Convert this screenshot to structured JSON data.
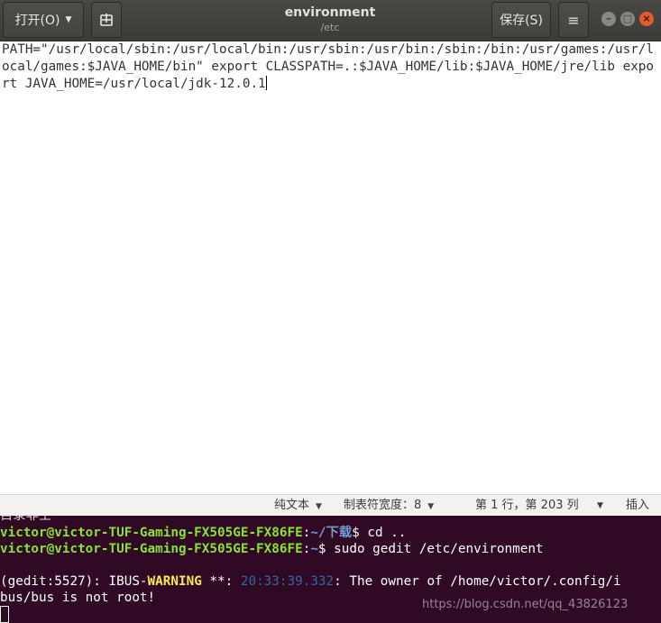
{
  "window": {
    "title": "environment",
    "subtitle": "/etc",
    "open_label": "打开(O)",
    "save_label": "保存(S)",
    "pin_icon": "new-document-icon",
    "menu_icon": "hamburger-menu-icon"
  },
  "editor": {
    "content": "PATH=\"/usr/local/sbin:/usr/local/bin:/usr/sbin:/usr/bin:/sbin:/bin:/usr/games:/usr/local/games:$JAVA_HOME/bin\" export CLASSPATH=.:$JAVA_HOME/lib:$JAVA_HOME/jre/lib export JAVA_HOME=/usr/local/jdk-12.0.1"
  },
  "statusbar": {
    "syntax": "纯文本",
    "tab_width": "制表符宽度：8",
    "position": "第 1 行，第 203 列",
    "mode": "插入"
  },
  "terminal": {
    "clipped_line": "目录非空",
    "line1_user": "victor@victor-TUF-Gaming-FX505GE-FX86FE",
    "line1_sep": ":",
    "line1_path": "~/下载",
    "line1_cmd": "$ cd ..",
    "line2_user": "victor@victor-TUF-Gaming-FX505GE-FX86FE",
    "line2_sep": ":",
    "line2_path": "~",
    "line2_cmd": "$ sudo gedit /etc/environment",
    "line3_prefix": "(gedit:5527): IBUS-",
    "line3_warning": "WARNING",
    "line3_mid": " **: ",
    "line3_time": "20:33:39.332",
    "line3_rest": ": The owner of /home/victor/.config/i",
    "line4": "bus/bus is not root!",
    "watermark": "https://blog.csdn.net/qq_43826123"
  },
  "colors": {
    "terminal_bg": "#300a24",
    "prompt_user": "#8ae234",
    "prompt_path": "#729fcf",
    "warning": "#fce94f",
    "close_button": "#e25a2e"
  }
}
